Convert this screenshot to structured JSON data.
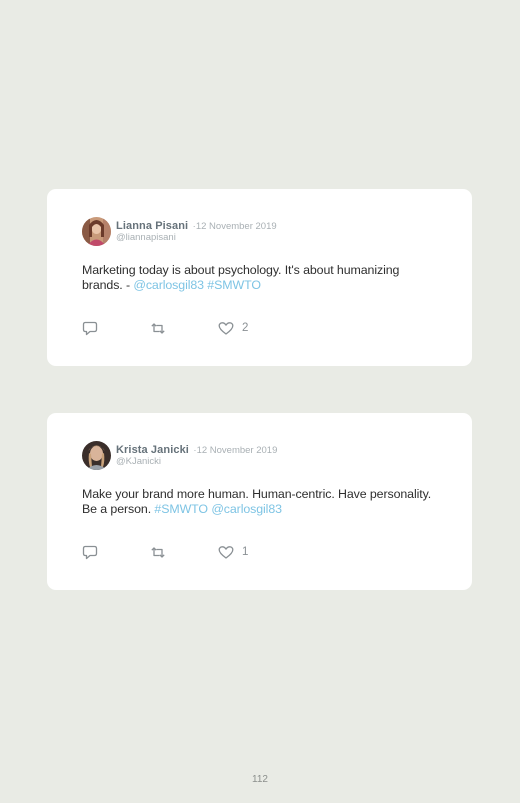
{
  "tweets": [
    {
      "author": "Lianna Pisani",
      "separator": "·",
      "date": "12 November 2019",
      "handle": "@liannapisani",
      "text_main": "Marketing today is about psychology. It's about humanizing brands. - ",
      "text_link_1": "@carlosgil83",
      "text_space": " ",
      "text_link_2": "#SMWTO",
      "likes": "2"
    },
    {
      "author": "Krista Janicki",
      "separator": "·",
      "date": "12 November 2019",
      "handle": "@KJanicki",
      "text_main": "Make your brand more human. Human-centric. Have personality. Be a person. ",
      "text_link_1": "#SMWTO",
      "text_space": " ",
      "text_link_2": "@carlosgil83",
      "likes": "1"
    }
  ],
  "icons": {
    "reply": "comment-icon",
    "retweet": "retweet-icon",
    "like": "heart-icon"
  },
  "colors": {
    "background": "#e9ebe5",
    "card": "#ffffff",
    "link": "#7ec4e4",
    "name": "#66727a",
    "meta": "#a9b0b4"
  },
  "page_number": "112"
}
